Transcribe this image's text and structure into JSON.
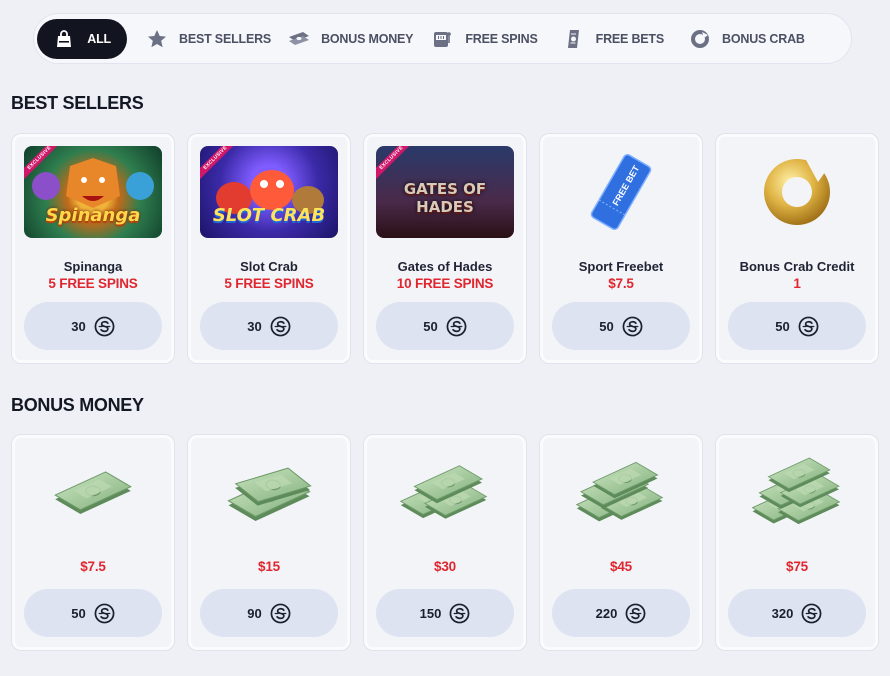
{
  "filters": [
    {
      "label": "ALL",
      "icon": "bag-icon",
      "active": true
    },
    {
      "label": "BEST SELLERS",
      "icon": "star-icon"
    },
    {
      "label": "BONUS MONEY",
      "icon": "money-icon"
    },
    {
      "label": "FREE SPINS",
      "icon": "slot-machine-icon"
    },
    {
      "label": "FREE BETS",
      "icon": "ticket-icon"
    },
    {
      "label": "BONUS CRAB",
      "icon": "crab-coin-icon"
    }
  ],
  "best_sellers": {
    "title": "BEST SELLERS",
    "items": [
      {
        "name": "Spinanga",
        "prize": "5 FREE SPINS",
        "price": "30",
        "badge": "EXCLUSIVE",
        "art_text": "Spinanga"
      },
      {
        "name": "Slot Crab",
        "prize": "5 FREE SPINS",
        "price": "30",
        "badge": "EXCLUSIVE",
        "art_text": "SLOT CRAB"
      },
      {
        "name": "Gates of Hades",
        "prize": "10 FREE SPINS",
        "price": "50",
        "badge": "EXCLUSIVE",
        "art_text": "GATES OF HADES"
      },
      {
        "name": "Sport Freebet",
        "prize": "$7.5",
        "price": "50",
        "art_text": "FREE BET"
      },
      {
        "name": "Bonus Crab Credit",
        "prize": "1",
        "price": "50"
      }
    ]
  },
  "bonus_money": {
    "title": "BONUS MONEY",
    "items": [
      {
        "prize": "$7.5",
        "price": "50"
      },
      {
        "prize": "$15",
        "price": "90"
      },
      {
        "prize": "$30",
        "price": "150"
      },
      {
        "prize": "$45",
        "price": "220"
      },
      {
        "prize": "$75",
        "price": "320"
      }
    ]
  },
  "colors": {
    "accent_red": "#e0262f",
    "button_bg": "#dde3f0",
    "active_chip": "#12151f"
  }
}
